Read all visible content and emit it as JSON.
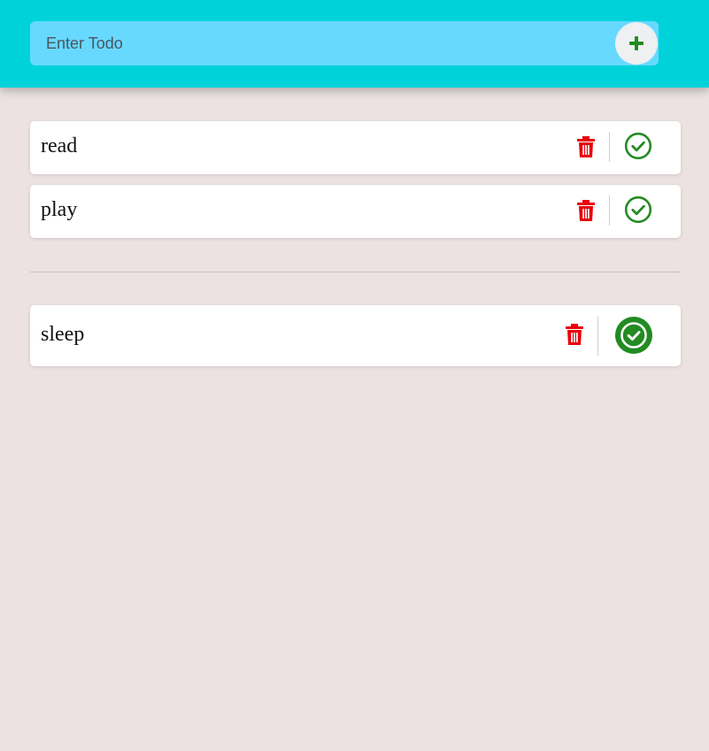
{
  "colors": {
    "header_bg": "#00d2da",
    "input_bg": "#67d9ff",
    "page_bg": "#ebe2e1",
    "delete": "#e8000b",
    "complete": "#228b22"
  },
  "input": {
    "placeholder": "Enter Todo",
    "value": "",
    "add_icon": "plus-icon"
  },
  "pending_todos": [
    {
      "text": "read",
      "delete_icon": "trash-icon",
      "complete_icon": "check-circle-outline-icon"
    },
    {
      "text": "play",
      "delete_icon": "trash-icon",
      "complete_icon": "check-circle-outline-icon"
    }
  ],
  "completed_todos": [
    {
      "text": "sleep",
      "delete_icon": "trash-icon",
      "complete_icon": "check-circle-filled-icon"
    }
  ]
}
